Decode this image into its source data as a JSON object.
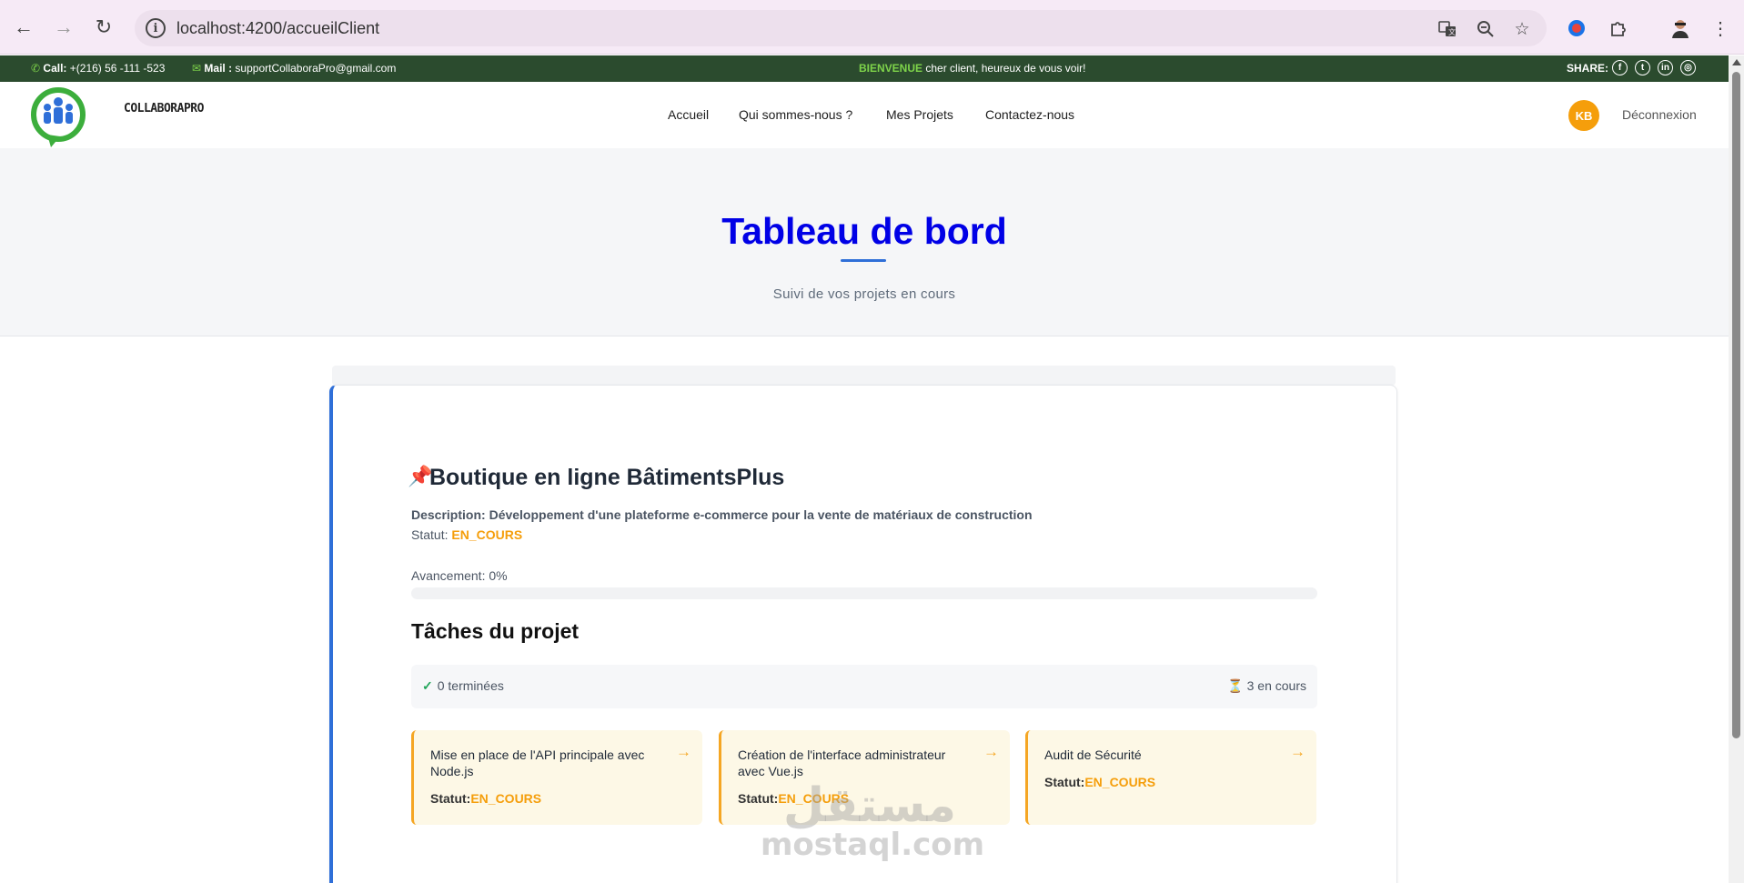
{
  "browser": {
    "url": "localhost:4200/accueilClient"
  },
  "topbar": {
    "call_label": "Call:",
    "call_value": "+(216) 56 -111 -523",
    "mail_label": "Mail :",
    "mail_value": "supportCollaboraPro@gmail.com",
    "welcome_highlight": "BIENVENUE",
    "welcome_rest": "cher client, heureux de vous voir!",
    "share_label": "SHARE:"
  },
  "header": {
    "logo_text": "COLLABORAPRO",
    "nav": [
      "Accueil",
      "Qui sommes-nous ?",
      "Mes Projets",
      "Contactez-nous"
    ],
    "avatar_initials": "KB",
    "logout_label": "Déconnexion"
  },
  "hero": {
    "title": "Tableau de bord",
    "subtitle": "Suivi de vos projets en cours"
  },
  "project": {
    "pin_emoji": "📌",
    "title": "Boutique en ligne BâtimentsPlus",
    "description_label": "Description:",
    "description": "Développement d'une plateforme e-commerce pour la vente de matériaux de construction",
    "status_label": "Statut:",
    "status": "EN_COURS",
    "progress_label": "Avancement: 0%",
    "progress_fraction": 0
  },
  "tasks": {
    "heading": "Tâches du projet",
    "done_summary": "0 terminées",
    "in_progress_summary": "3 en cours",
    "hourglass": "⏳",
    "items": [
      {
        "title": "Mise en place de l'API principale avec Node.js",
        "status_label": "Statut:",
        "status": "EN_COURS"
      },
      {
        "title": "Création de l'interface administrateur avec Vue.js",
        "status_label": "Statut:",
        "status": "EN_COURS"
      },
      {
        "title": "Audit de Sécurité",
        "status_label": "Statut:",
        "status": "EN_COURS"
      }
    ]
  },
  "watermark": {
    "arabic": "مستقل",
    "latin": "mostaql.com"
  },
  "colors": {
    "accent_blue": "#0000e6",
    "topbar_bg": "#2b4b2e",
    "status_orange": "#f59e0b",
    "avatar_bg": "#f59e0b"
  }
}
